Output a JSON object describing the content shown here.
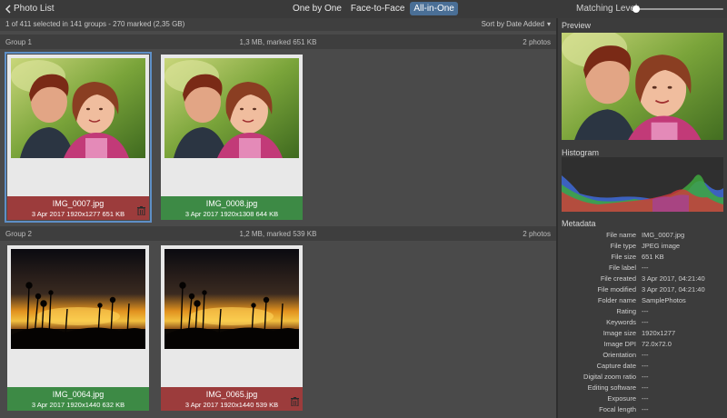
{
  "topbar": {
    "back_label": "Photo List",
    "modes": [
      "One by One",
      "Face-to-Face",
      "All-in-One"
    ],
    "active_mode": "All-in-One",
    "matching_label": "Matching Level:",
    "matching_level": 0.0
  },
  "infobar": {
    "selection": "1 of 411 selected in 141 groups - 270 marked (2,35 GB)",
    "sort": "Sort by Date Added"
  },
  "groups": [
    {
      "name": "Group 1",
      "size": "1,3 MB, marked 651 KB",
      "count": "2 photos",
      "photos": [
        {
          "file": "IMG_0007.jpg",
          "meta": "3 Apr 2017  1920x1277  651 KB",
          "status": "marked"
        },
        {
          "file": "IMG_0008.jpg",
          "meta": "3 Apr 2017  1920x1308  644 KB",
          "status": "kept"
        }
      ]
    },
    {
      "name": "Group 2",
      "size": "1,2 MB, marked 539 KB",
      "count": "2 photos",
      "photos": [
        {
          "file": "IMG_0064.jpg",
          "meta": "3 Apr 2017  1920x1440  632 KB",
          "status": "kept"
        },
        {
          "file": "IMG_0065.jpg",
          "meta": "3 Apr 2017  1920x1440  539 KB",
          "status": "marked"
        }
      ]
    }
  ],
  "right": {
    "preview_title": "Preview",
    "histogram_title": "Histogram",
    "metadata_title": "Metadata",
    "metadata": [
      {
        "k": "File name",
        "v": "IMG_0007.jpg"
      },
      {
        "k": "File type",
        "v": "JPEG image"
      },
      {
        "k": "File size",
        "v": "651 KB"
      },
      {
        "k": "File label",
        "v": "---"
      },
      {
        "k": "File created",
        "v": "3 Apr 2017, 04:21:40"
      },
      {
        "k": "File modified",
        "v": "3 Apr 2017, 04:21:40"
      },
      {
        "k": "Folder name",
        "v": "SamplePhotos"
      },
      {
        "k": "Rating",
        "v": "---"
      },
      {
        "k": "Keywords",
        "v": "---"
      },
      {
        "k": "Image size",
        "v": "1920x1277"
      },
      {
        "k": "Image DPI",
        "v": "72.0x72.0"
      },
      {
        "k": "Orientation",
        "v": "---"
      },
      {
        "k": "Capture date",
        "v": "---"
      },
      {
        "k": "Digital zoom ratio",
        "v": "---"
      },
      {
        "k": "Editing software",
        "v": "---"
      },
      {
        "k": "Exposure",
        "v": "---"
      },
      {
        "k": "Focal length",
        "v": "---"
      }
    ]
  },
  "colors": {
    "accent": "#4a6f96",
    "marked": "#9c3c3c",
    "kept": "#3d8a45"
  }
}
